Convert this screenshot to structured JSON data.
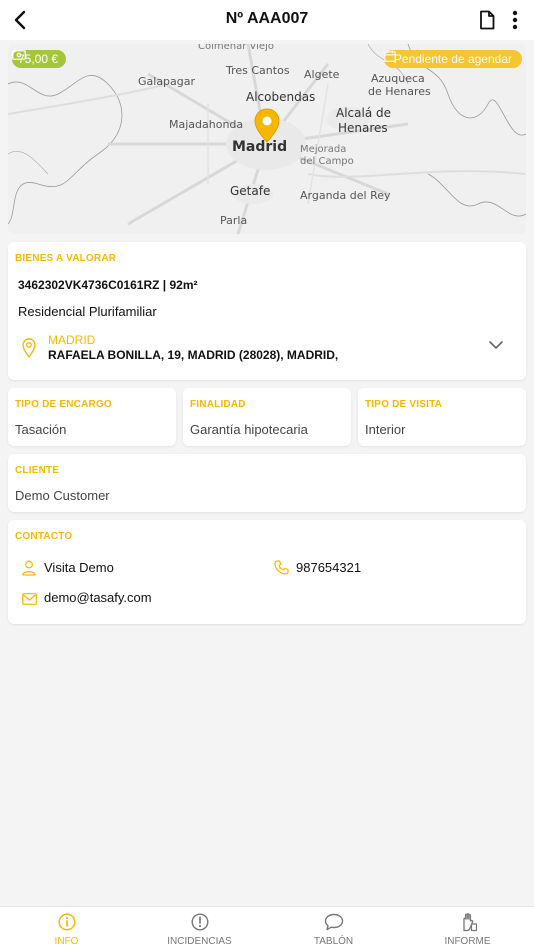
{
  "header": {
    "title": "Nº AAA007"
  },
  "map": {
    "price": "75,00 €",
    "status": "Pendiente de agendar",
    "labels": {
      "colmenar": "Colmenar Viejo",
      "tres_cantos": "Tres Cantos",
      "algete": "Algete",
      "galapagar": "Galapagar",
      "azuqueca": "Azuqueca",
      "de_henares_1": "de Henares",
      "alcobendas": "Alcobendas",
      "alcala": "Alcalá de",
      "henares": "Henares",
      "majadahonda": "Majadahonda",
      "madrid": "Madrid",
      "mejorada": "Mejorada",
      "del_campo": "del Campo",
      "getafe": "Getafe",
      "arganda": "Arganda del Rey",
      "parla": "Parla"
    }
  },
  "bienes": {
    "label": "BIENES A VALORAR",
    "reference": "3462302VK4736C0161RZ | 92m²",
    "type": "Residencial Plurifamiliar",
    "city": "MADRID",
    "address": "RAFAELA BONILLA, 19, MADRID (28028), MADRID,"
  },
  "encargo": {
    "label": "TIPO DE ENCARGO",
    "value": "Tasación"
  },
  "finalidad": {
    "label": "FINALIDAD",
    "value": "Garantía hipotecaria"
  },
  "visita": {
    "label": "TIPO DE VISITA",
    "value": "Interior"
  },
  "cliente": {
    "label": "CLIENTE",
    "value": "Demo Customer"
  },
  "contacto": {
    "label": "CONTACTO",
    "name": "Visita Demo",
    "phone": "987654321",
    "email": "demo@tasafy.com"
  },
  "nav": {
    "info": "INFO",
    "incidencias": "INCIDENCIAS",
    "tablon": "TABLÓN",
    "informe": "INFORME"
  },
  "colors": {
    "accent": "#f5b800",
    "price_badge": "#a5c63b",
    "status_badge": "#f7c530"
  }
}
